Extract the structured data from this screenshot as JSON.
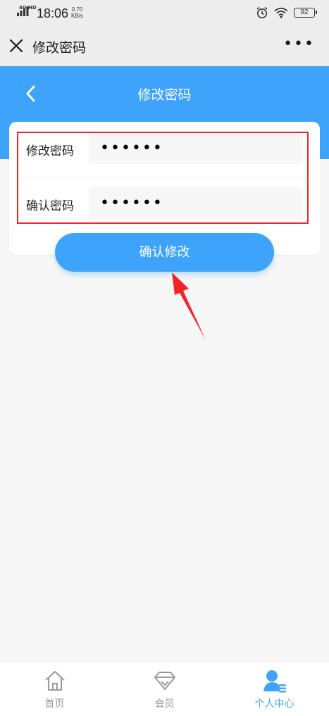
{
  "status_bar": {
    "network": "4G HD",
    "time": "18:06",
    "speed_value": "0.70",
    "speed_unit": "KB/s",
    "battery": "92"
  },
  "app_bar": {
    "title": "修改密码",
    "close_icon": "close-icon",
    "more_icon": "more-dots-icon"
  },
  "header": {
    "title": "修改密码",
    "back_icon": "back-chevron-icon"
  },
  "form": {
    "new_password_label": "修改密码",
    "new_password_value": "••••••",
    "confirm_password_label": "确认密码",
    "confirm_password_value": "••••••"
  },
  "confirm_button": "确认修改",
  "bottom_nav": {
    "items": [
      {
        "label": "首页",
        "icon": "home-icon",
        "active": false
      },
      {
        "label": "会员",
        "icon": "diamond-icon",
        "active": false
      },
      {
        "label": "个人中心",
        "icon": "user-center-icon",
        "active": true
      }
    ]
  },
  "colors": {
    "primary": "#3ea3fb",
    "annotation_red": "#f22424",
    "inactive_gray": "#999999"
  }
}
